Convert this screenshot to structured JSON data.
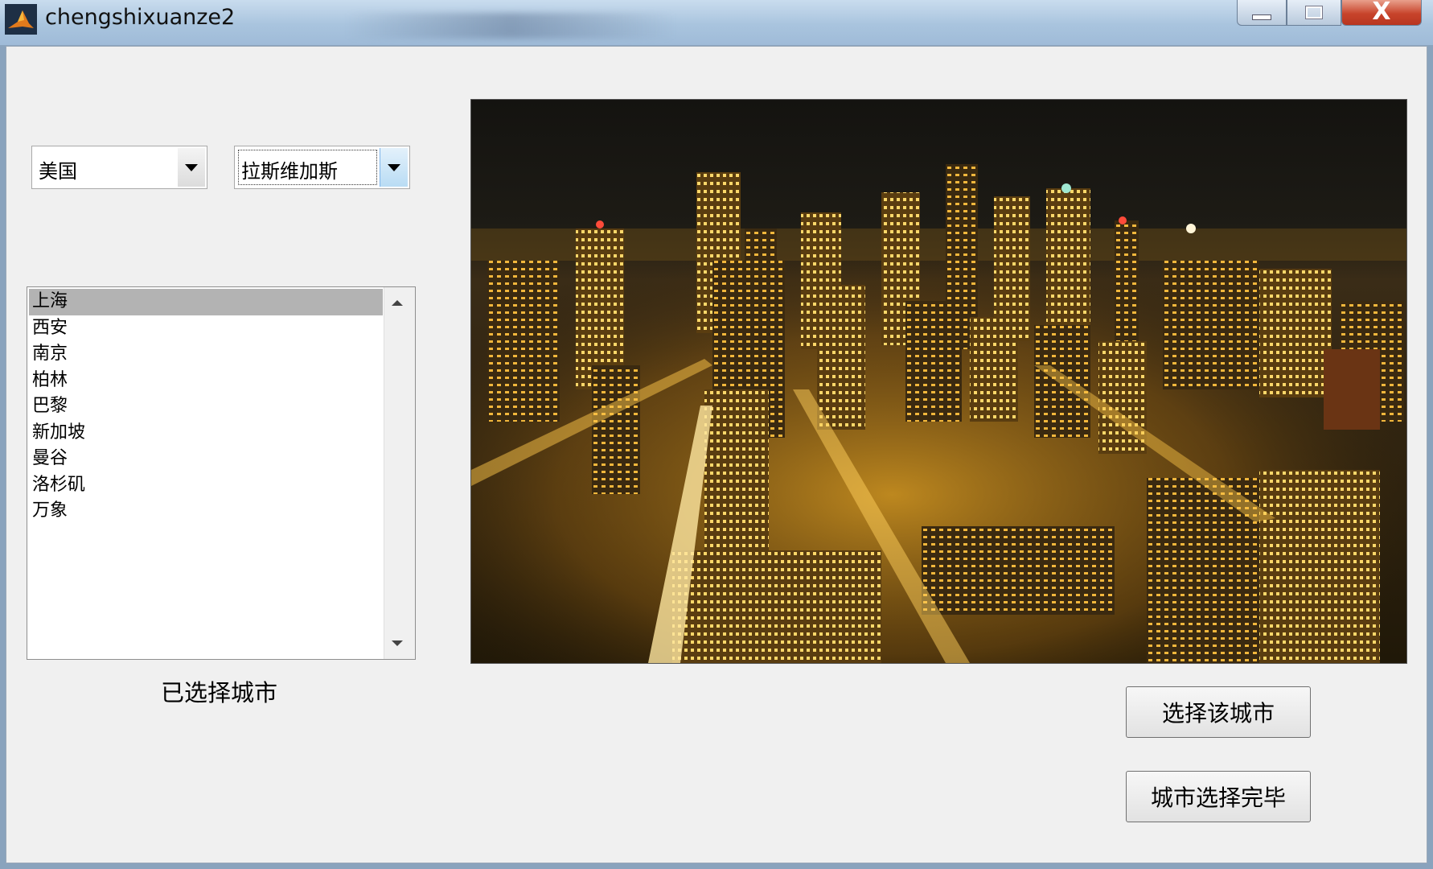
{
  "window": {
    "title": "chengshixuanze2",
    "controls": [
      "minimize",
      "maximize",
      "close"
    ],
    "close_glyph": "X"
  },
  "dropdowns": {
    "country": {
      "selected": "美国"
    },
    "city": {
      "selected": "拉斯维加斯"
    }
  },
  "city_list": {
    "items": [
      "上海",
      "西安",
      "南京",
      "柏林",
      "巴黎",
      "新加坡",
      "曼谷",
      "洛杉矶",
      "万象"
    ],
    "selected_index": 0
  },
  "labels": {
    "selected_cities": "已选择城市"
  },
  "buttons": {
    "select_city": "选择该城市",
    "done": "城市选择完毕"
  },
  "colors": {
    "title_bar": "#a9c4de",
    "close_button": "#c8442b",
    "list_selection": "#b3b3b3",
    "client_bg": "#f0f0f0"
  }
}
